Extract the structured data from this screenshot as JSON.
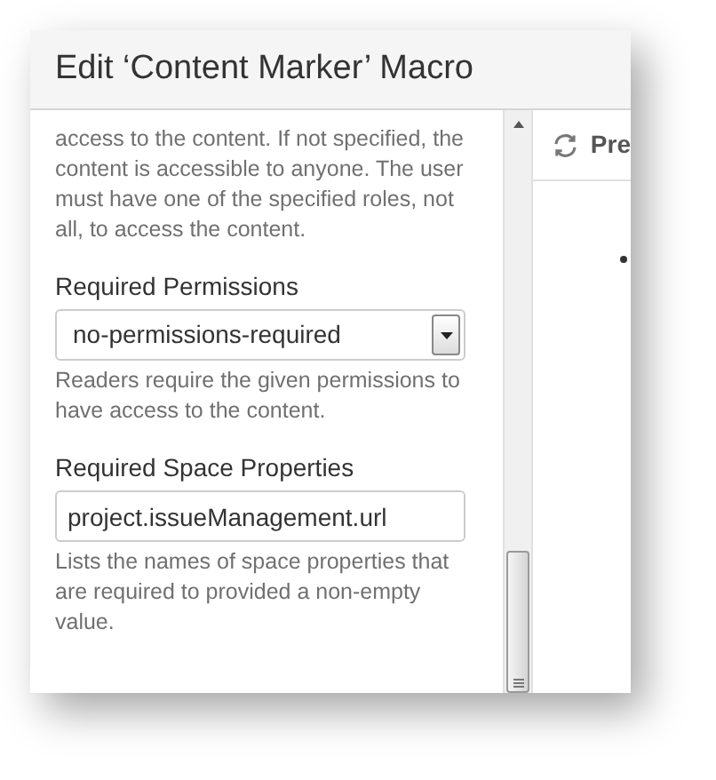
{
  "dialog": {
    "title": "Edit ‘Content Marker’ Macro"
  },
  "form": {
    "intro_lines": [
      "access to the content. If not specified, the",
      "content is accessible to anyone. The user",
      "must have one of the specified roles, not",
      "all, to access the content."
    ],
    "fields": [
      {
        "kind": "select",
        "label": "Required Permissions",
        "value": "no-permissions-required",
        "help": "Readers require the given permissions to have access to the content."
      },
      {
        "kind": "text",
        "label": "Required Space Properties",
        "value": "project.issueManagement.url",
        "help": "Lists the names of space properties that are required to provided a non-empty value."
      }
    ]
  },
  "preview": {
    "button_label": "Pre"
  }
}
